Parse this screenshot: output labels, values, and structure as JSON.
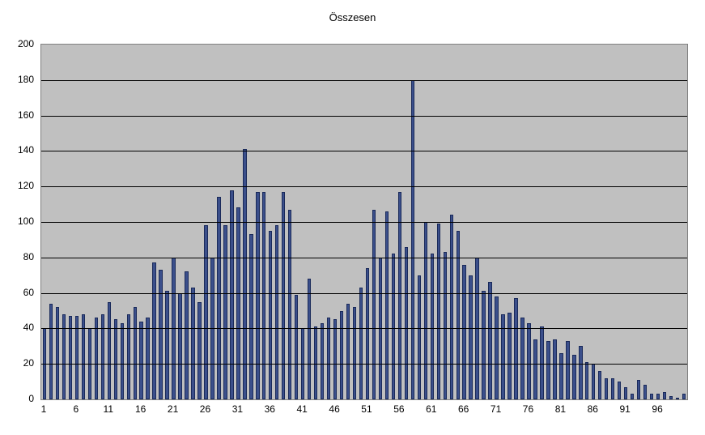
{
  "chart_data": {
    "type": "bar",
    "title": "Összesen",
    "xlabel": "",
    "ylabel": "",
    "ylim": [
      0,
      200
    ],
    "y_ticks": [
      0,
      20,
      40,
      60,
      80,
      100,
      120,
      140,
      160,
      180,
      200
    ],
    "x_tick_labels": [
      1,
      6,
      11,
      16,
      21,
      26,
      31,
      36,
      41,
      46,
      51,
      56,
      61,
      66,
      71,
      76,
      81,
      86,
      91,
      96
    ],
    "categories": [
      1,
      2,
      3,
      4,
      5,
      6,
      7,
      8,
      9,
      10,
      11,
      12,
      13,
      14,
      15,
      16,
      17,
      18,
      19,
      20,
      21,
      22,
      23,
      24,
      25,
      26,
      27,
      28,
      29,
      30,
      31,
      32,
      33,
      34,
      35,
      36,
      37,
      38,
      39,
      40,
      41,
      42,
      43,
      44,
      45,
      46,
      47,
      48,
      49,
      50,
      51,
      52,
      53,
      54,
      55,
      56,
      57,
      58,
      59,
      60,
      61,
      62,
      63,
      64,
      65,
      66,
      67,
      68,
      69,
      70,
      71,
      72,
      73,
      74,
      75,
      76,
      77,
      78,
      79,
      80,
      81,
      82,
      83,
      84,
      85,
      86,
      87,
      88,
      89,
      90,
      91,
      92,
      93,
      94,
      95,
      96,
      97,
      98,
      99,
      100
    ],
    "values": [
      40,
      54,
      52,
      48,
      47,
      47,
      48,
      40,
      46,
      48,
      55,
      45,
      43,
      48,
      52,
      44,
      46,
      77,
      73,
      61,
      80,
      60,
      72,
      63,
      55,
      98,
      80,
      114,
      98,
      118,
      108,
      141,
      93,
      117,
      117,
      95,
      98,
      117,
      107,
      59,
      40,
      68,
      41,
      43,
      46,
      45,
      50,
      54,
      52,
      63,
      74,
      107,
      80,
      106,
      82,
      117,
      86,
      180,
      70,
      100,
      82,
      99,
      83,
      104,
      95,
      76,
      70,
      80,
      61,
      66,
      58,
      48,
      49,
      57,
      46,
      43,
      34,
      41,
      33,
      34,
      26,
      33,
      25,
      30,
      21,
      20,
      16,
      12,
      12,
      10,
      7,
      3,
      11,
      8,
      3,
      3,
      4,
      2,
      1,
      3
    ]
  }
}
